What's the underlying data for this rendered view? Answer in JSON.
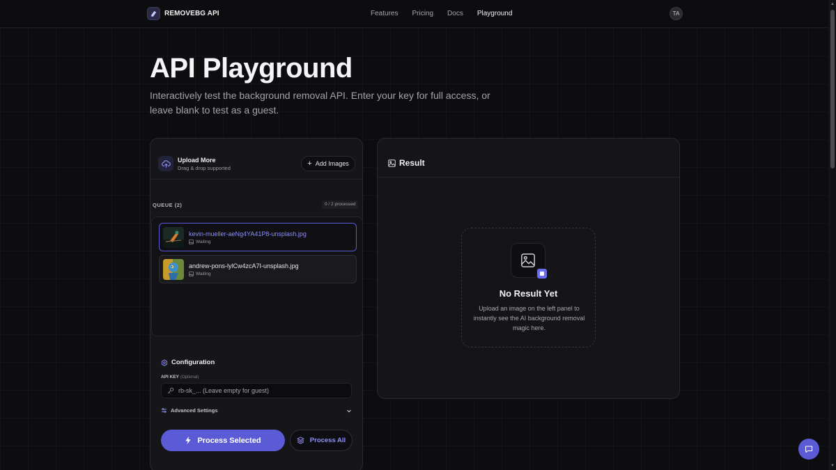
{
  "header": {
    "brand": "REMOVEBG API",
    "nav": [
      "Features",
      "Pricing",
      "Docs",
      "Playground"
    ],
    "active_nav": "Playground",
    "avatar_initials": "TA"
  },
  "hero": {
    "title": "API Playground",
    "subtitle": "Interactively test the background removal API. Enter your key for full access, or leave blank to test as a guest."
  },
  "upload": {
    "title": "Upload More",
    "subtitle": "Drag & drop supported",
    "add_button": "Add Images"
  },
  "queue": {
    "label": "QUEUE (2)",
    "processed": "0 / 2 processed",
    "items": [
      {
        "name": "kevin-mueller-aeNg4YA41P8-unsplash.jpg",
        "status": "Waiting",
        "selected": true
      },
      {
        "name": "andrew-pons-lylCw4zcA7I-unsplash.jpg",
        "status": "Waiting",
        "selected": false
      }
    ]
  },
  "config": {
    "title": "Configuration",
    "api_key_label": "API KEY",
    "api_key_optional": "(Optional)",
    "api_key_placeholder": "rb-sk_... (Leave empty for guest)",
    "advanced_label": "Advanced Settings",
    "process_selected": "Process Selected",
    "process_all": "Process All"
  },
  "result": {
    "title": "Result",
    "empty_title": "No Result Yet",
    "empty_text": "Upload an image on the left panel to instantly see the AI background removal magic here."
  },
  "colors": {
    "accent": "#5b5bd6",
    "accent_text": "#8f8ff5",
    "background": "#0d0d0f",
    "panel": "#161618"
  }
}
